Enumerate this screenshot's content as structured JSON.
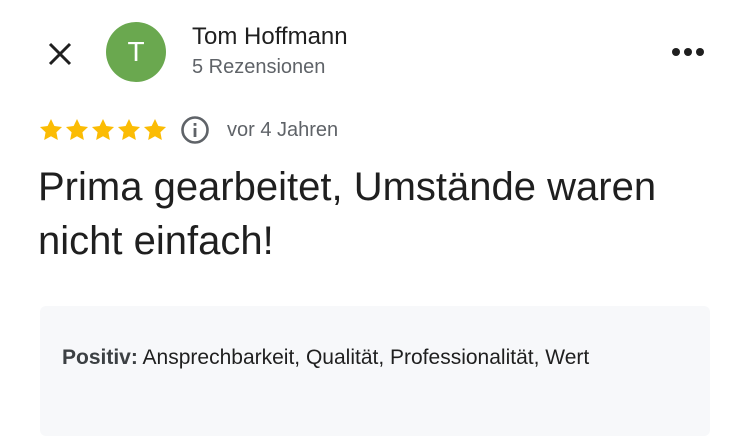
{
  "header": {
    "close_icon": "close-icon",
    "avatar_letter": "T",
    "avatar_color": "#6aa84f",
    "author_name": "Tom Hoffmann",
    "review_count": "5 Rezensionen",
    "more_icon": "more-vert-icon"
  },
  "rating": {
    "stars": 5,
    "max_stars": 5,
    "star_color": "#fbbc04",
    "info_icon": "info-icon",
    "time_ago": "vor 4 Jahren"
  },
  "review": {
    "title": "Prima gearbeitet, Umstände waren nicht einfach!"
  },
  "attributes": {
    "label": "Positiv:",
    "values": "Ansprechbarkeit, Qualität, Professionalität, Wert"
  }
}
